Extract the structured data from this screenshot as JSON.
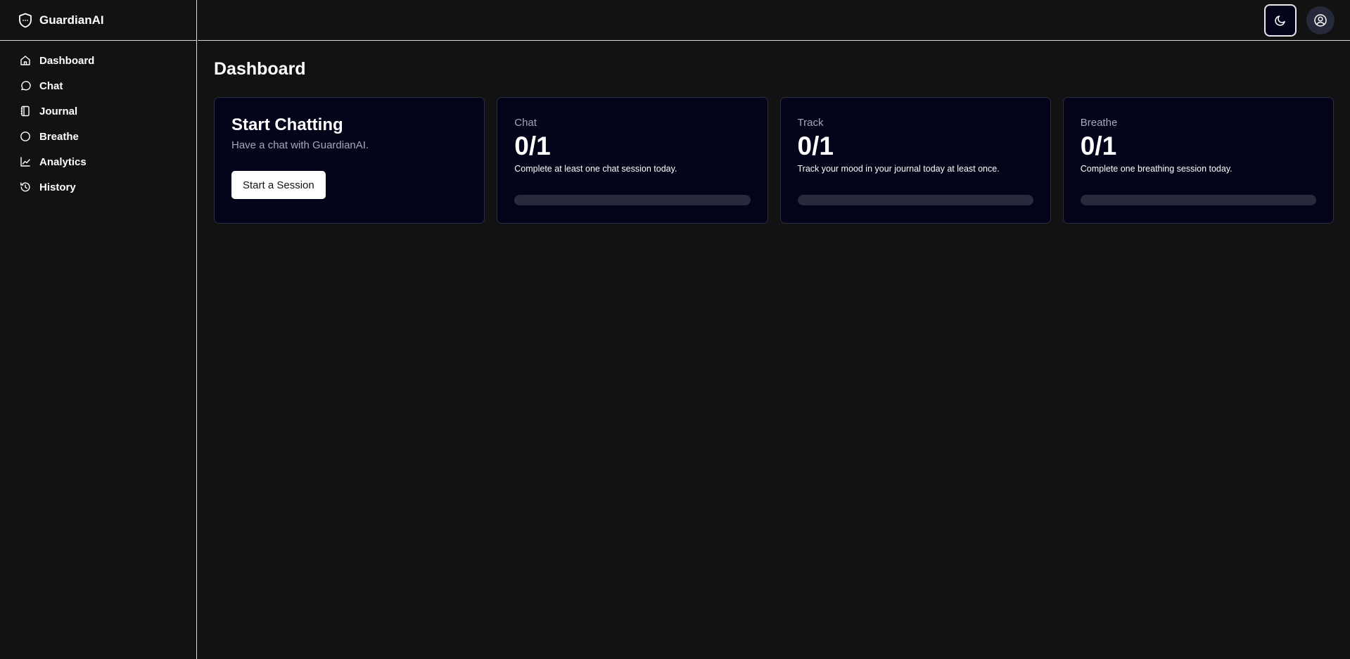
{
  "brand": {
    "name": "GuardianAI"
  },
  "sidebar": {
    "items": [
      {
        "label": "Dashboard",
        "icon": "home-icon"
      },
      {
        "label": "Chat",
        "icon": "message-circle-icon"
      },
      {
        "label": "Journal",
        "icon": "notebook-icon"
      },
      {
        "label": "Breathe",
        "icon": "circle-icon"
      },
      {
        "label": "Analytics",
        "icon": "line-chart-icon"
      },
      {
        "label": "History",
        "icon": "history-icon"
      }
    ]
  },
  "header": {
    "theme_toggle_icon": "moon-icon",
    "account_icon": "user-circle-icon"
  },
  "main": {
    "title": "Dashboard",
    "start_card": {
      "title": "Start Chatting",
      "subtitle": "Have a chat with GuardianAI.",
      "button_label": "Start a Session"
    },
    "goals": [
      {
        "label": "Chat",
        "value": "0/1",
        "description": "Complete at least one chat session today.",
        "progress": 0
      },
      {
        "label": "Track",
        "value": "0/1",
        "description": "Track your mood in your journal today at least once.",
        "progress": 0
      },
      {
        "label": "Breathe",
        "value": "0/1",
        "description": "Complete one breathing session today.",
        "progress": 0
      }
    ]
  },
  "colors": {
    "background": "#121212",
    "card_background": "#030319",
    "card_border": "#2b2e42",
    "progress_track": "#262a3c",
    "muted_text": "#a4a8bc"
  }
}
